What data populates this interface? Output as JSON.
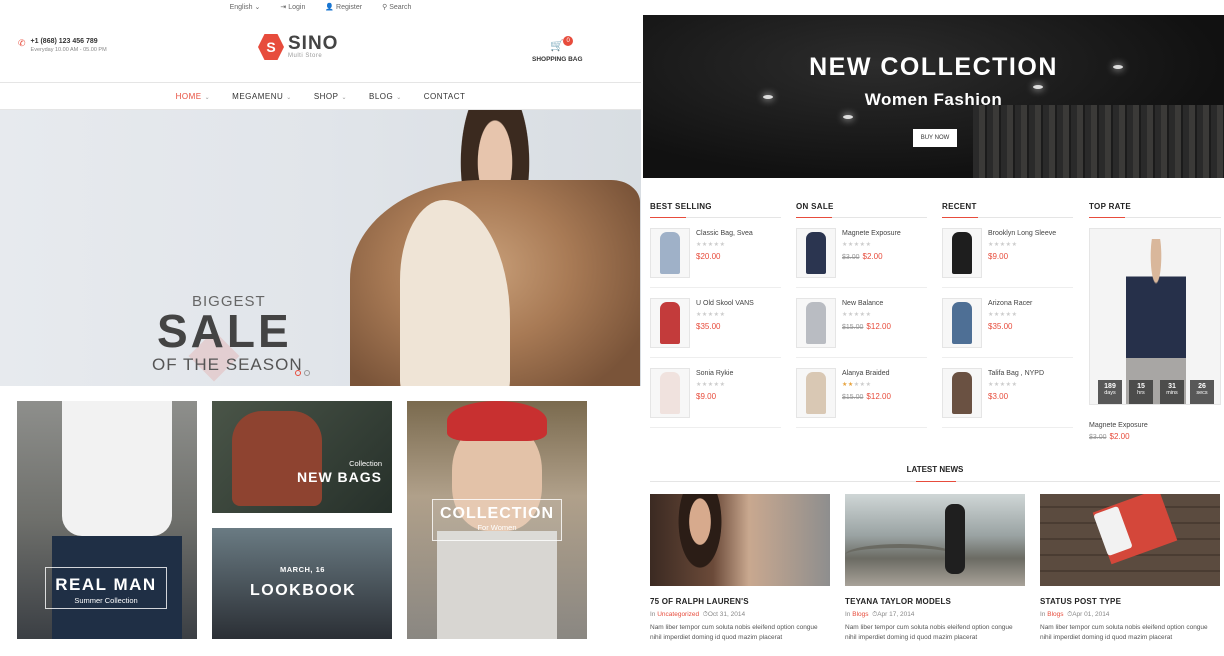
{
  "topbar": {
    "language": "English",
    "login": "Login",
    "register": "Register",
    "search": "Search"
  },
  "header": {
    "phone": "+1 (868) 123 456 789",
    "hours": "Everyday 10.00 AM - 05.00 PM",
    "logo_name": "SINO",
    "logo_tag": "Multi Store",
    "cart_label": "SHOPPING BAG",
    "cart_count": "0"
  },
  "nav": {
    "items": [
      {
        "label": "HOME",
        "has_menu": true
      },
      {
        "label": "MEGAMENU",
        "has_menu": true
      },
      {
        "label": "SHOP",
        "has_menu": true
      },
      {
        "label": "BLOG",
        "has_menu": true
      },
      {
        "label": "CONTACT",
        "has_menu": false
      }
    ]
  },
  "hero": {
    "line1": "BIGGEST",
    "line2": "SALE",
    "line3": "OF THE SEASON"
  },
  "banners": {
    "real_man": {
      "title": "REAL MAN",
      "subtitle": "Summer Collection"
    },
    "new_bags": {
      "title": "NEW BAGS",
      "subtitle": "Collection"
    },
    "lookbook": {
      "title": "LOOKBOOK",
      "subtitle": "MARCH, 16"
    },
    "collection": {
      "title": "COLLECTION",
      "subtitle": "For Women"
    }
  },
  "new_collection": {
    "title": "NEW COLLECTION",
    "subtitle": "Women Fashion",
    "button": "BUY NOW"
  },
  "product_columns": [
    {
      "heading": "BEST SELLING",
      "products": [
        {
          "name": "Classic Bag, Svea",
          "old_price": "",
          "price": "$20.00",
          "rating": 0,
          "color": "#9fb1c8"
        },
        {
          "name": "U Old Skool VANS",
          "old_price": "",
          "price": "$35.00",
          "rating": 0,
          "color": "#c33b3b"
        },
        {
          "name": "Sonia Rykie",
          "old_price": "",
          "price": "$9.00",
          "rating": 0,
          "color": "#f0e2de"
        }
      ]
    },
    {
      "heading": "ON SALE",
      "products": [
        {
          "name": "Magnete Exposure",
          "old_price": "$3.00",
          "price": "$2.00",
          "rating": 0,
          "color": "#2b3550"
        },
        {
          "name": "New Balance",
          "old_price": "$15.00",
          "price": "$12.00",
          "rating": 0,
          "color": "#b9bcc2"
        },
        {
          "name": "Alanya Braided",
          "old_price": "$15.00",
          "price": "$12.00",
          "rating": 2,
          "color": "#d9c8b4"
        }
      ]
    },
    {
      "heading": "RECENT",
      "products": [
        {
          "name": "Brooklyn Long Sleeve",
          "old_price": "",
          "price": "$9.00",
          "rating": 0,
          "color": "#1e1e1e"
        },
        {
          "name": "Arizona Racer",
          "old_price": "",
          "price": "$35.00",
          "rating": 0,
          "color": "#4e6f95"
        },
        {
          "name": "Talifa Bag , NYPD",
          "old_price": "",
          "price": "$3.00",
          "rating": 0,
          "color": "#6a5142"
        }
      ]
    }
  ],
  "top_rate": {
    "heading": "TOP RATE",
    "name": "Magnete Exposure",
    "old_price": "$3.00",
    "price": "$2.00",
    "countdown": [
      {
        "value": "189",
        "unit": "days"
      },
      {
        "value": "15",
        "unit": "hrs"
      },
      {
        "value": "31",
        "unit": "mins"
      },
      {
        "value": "26",
        "unit": "secs"
      }
    ]
  },
  "latest_news": {
    "heading": "LATEST NEWS",
    "posts": [
      {
        "title": "75 OF RALPH LAUREN'S",
        "prefix": "In",
        "category": "Uncategorized",
        "date": "Oct 31, 2014",
        "excerpt": "Nam liber tempor cum soluta nobis eleifend option congue nihil imperdiet doming id quod mazim placerat"
      },
      {
        "title": "TEYANA TAYLOR MODELS",
        "prefix": "In",
        "category": "Blogs",
        "date": "Apr 17, 2014",
        "excerpt": "Nam liber tempor cum soluta nobis eleifend option congue nihil imperdiet doming id quod mazim placerat"
      },
      {
        "title": "STATUS POST TYPE",
        "prefix": "In",
        "category": "Blogs",
        "date": "Apr 01, 2014",
        "excerpt": "Nam liber tempor cum soluta nobis eleifend option congue nihil imperdiet doming id quod mazim placerat"
      }
    ]
  },
  "colors": {
    "accent": "#e74c3c",
    "text": "#333333",
    "star": "#e7a33e"
  }
}
